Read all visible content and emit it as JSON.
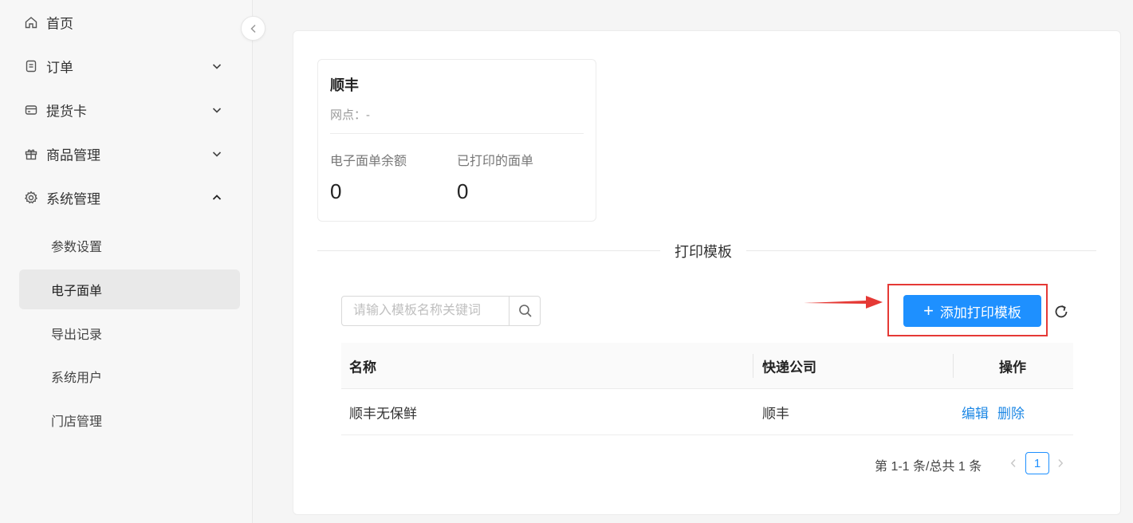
{
  "sidebar": {
    "items": [
      {
        "label": "首页",
        "icon": "home-icon"
      },
      {
        "label": "订单",
        "icon": "document-icon",
        "arrow": "chevron-down-icon"
      },
      {
        "label": "提货卡",
        "icon": "card-icon",
        "arrow": "chevron-down-icon"
      },
      {
        "label": "商品管理",
        "icon": "gift-icon",
        "arrow": "chevron-down-icon"
      },
      {
        "label": "系统管理",
        "icon": "gear-icon",
        "arrow": "chevron-up-icon"
      }
    ],
    "sub_items": [
      {
        "label": "参数设置"
      },
      {
        "label": "电子面单",
        "active": true
      },
      {
        "label": "导出记录"
      },
      {
        "label": "系统用户"
      },
      {
        "label": "门店管理"
      }
    ]
  },
  "card": {
    "title": "顺丰",
    "subtitle": "网点：-",
    "stats": [
      {
        "label": "电子面单余额",
        "value": "0"
      },
      {
        "label": "已打印的面单",
        "value": "0"
      }
    ]
  },
  "section_title": "打印模板",
  "search": {
    "placeholder": "请输入模板名称关键词",
    "value": ""
  },
  "add_button": {
    "plus": "+",
    "label": "添加打印模板"
  },
  "table": {
    "headers": [
      "名称",
      "快递公司",
      "操作"
    ],
    "rows": [
      {
        "name": "顺丰无保鲜",
        "company": "顺丰",
        "edit": "编辑",
        "delete": "删除"
      }
    ]
  },
  "pagination": {
    "summary": "第 1-1 条/总共 1 条",
    "current": "1"
  },
  "colors": {
    "accent": "#1e90ff",
    "link": "#1e88e5",
    "highlight": "#e53935"
  }
}
